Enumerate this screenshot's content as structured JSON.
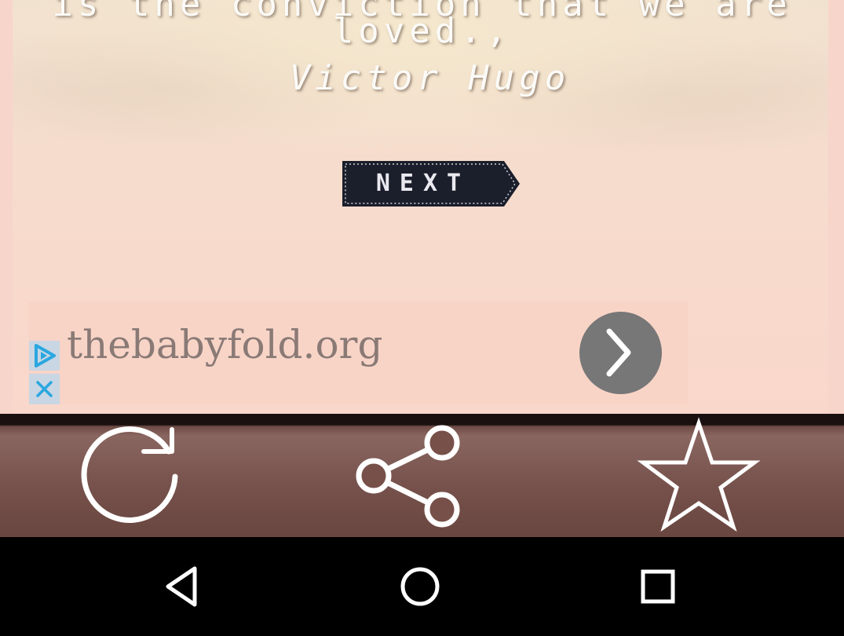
{
  "quote": {
    "partial_line": "is the conviction that we are",
    "line": "loved.,",
    "author": "Victor Hugo"
  },
  "next_button": {
    "label": "NEXT"
  },
  "ad": {
    "domain": "thebabyfold.org"
  },
  "toolbar": {
    "items": [
      "refresh-icon",
      "share-icon",
      "star-icon"
    ]
  },
  "navbar": {
    "items": [
      "back-icon",
      "home-icon",
      "recents-icon"
    ]
  },
  "colors": {
    "content_bg": "#f8d5ca",
    "toolbar": "#76514b",
    "navbar": "#000000",
    "ad_button": "#777777"
  }
}
